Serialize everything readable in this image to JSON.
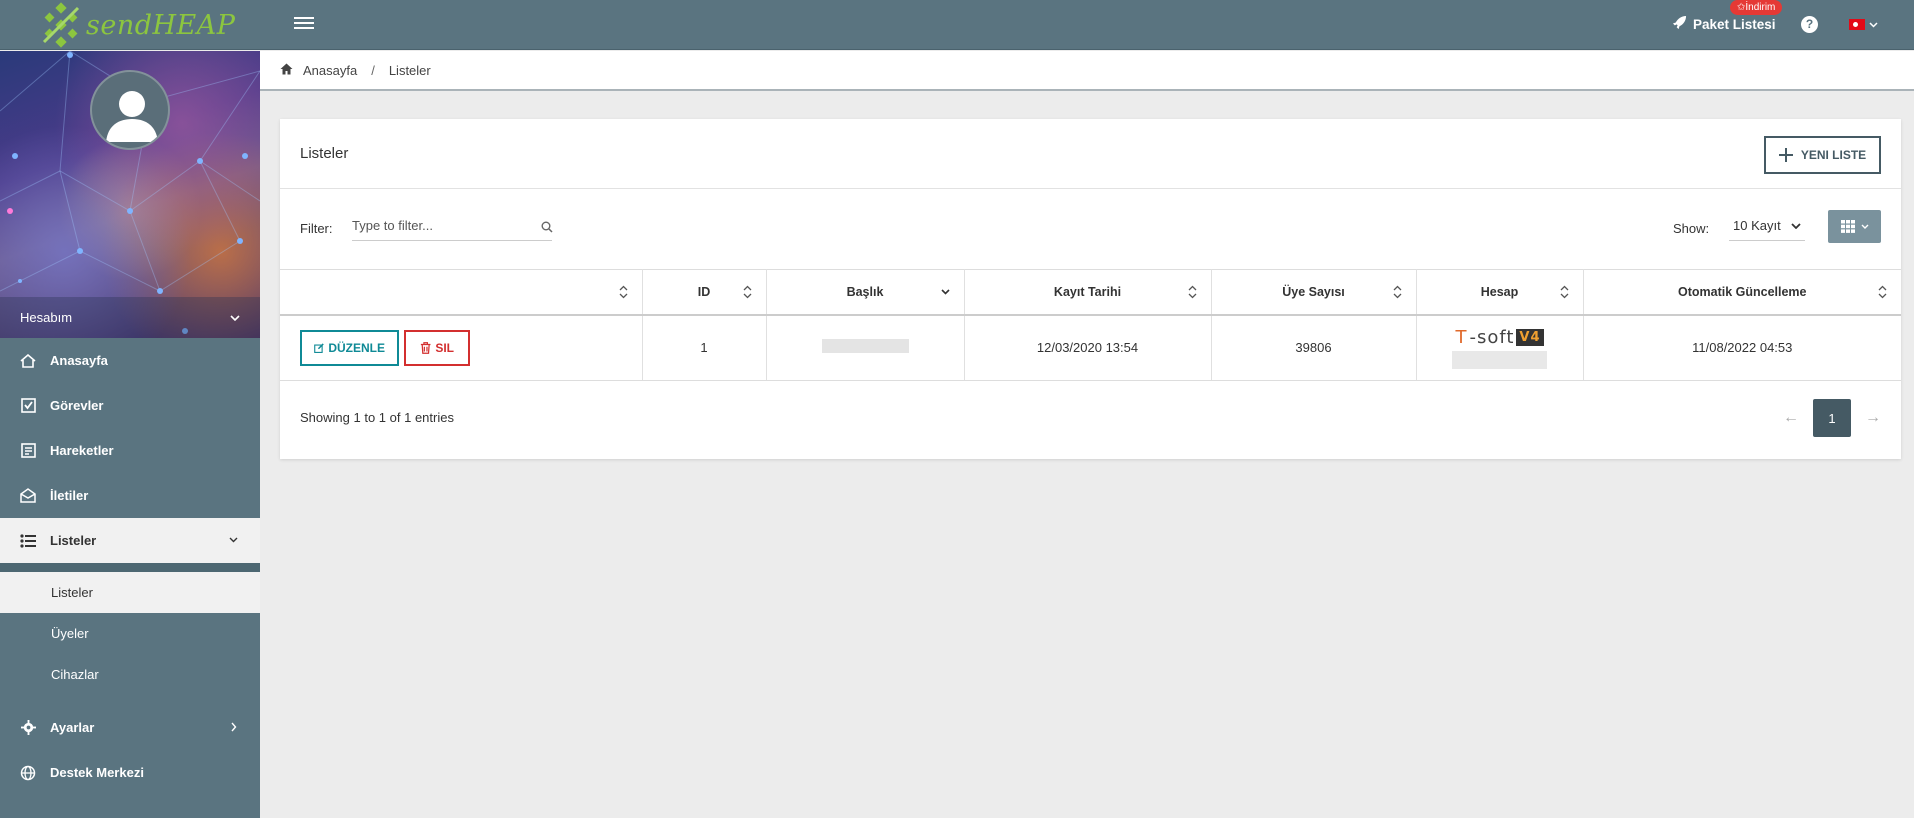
{
  "brand": {
    "name_send": "send",
    "name_heap": "HEAP"
  },
  "topbar": {
    "paket_label": "Paket Listesi",
    "indirim_badge": "✩İndirim",
    "help_glyph": "?"
  },
  "sidebar": {
    "account_label": "Hesabım",
    "items": [
      {
        "label": "Anasayfa",
        "icon": "home-icon"
      },
      {
        "label": "Görevler",
        "icon": "checkbox-icon"
      },
      {
        "label": "Hareketler",
        "icon": "list-box-icon"
      },
      {
        "label": "İletiler",
        "icon": "envelope-icon"
      },
      {
        "label": "Listeler",
        "icon": "list-icon"
      },
      {
        "label": "Ayarlar",
        "icon": "gear-icon"
      },
      {
        "label": "Destek Merkezi",
        "icon": "globe-icon"
      }
    ],
    "sub_items": [
      "Listeler",
      "Üyeler",
      "Cihazlar"
    ]
  },
  "breadcrumb": {
    "home": "Anasayfa",
    "separator": "/",
    "current": "Listeler"
  },
  "card": {
    "title": "Listeler",
    "new_button": "YENI LISTE",
    "filter_label": "Filter:",
    "filter_placeholder": "Type to filter...",
    "show_label": "Show:",
    "show_value": "10 Kayıt"
  },
  "table": {
    "columns": [
      "",
      "ID",
      "Başlık",
      "Kayıt Tarihi",
      "Üye Sayısı",
      "Hesap",
      "Otomatik Güncelleme"
    ],
    "rows": [
      {
        "edit_label": "DÜZENLE",
        "delete_label": "SIL",
        "id": "1",
        "kayit_tarihi": "12/03/2020 13:54",
        "uye_sayisi": "39806",
        "hesap_logo": {
          "t": "T",
          "rest": "-soft",
          "v4": "V4"
        },
        "otomatik_guncelleme": "11/08/2022 04:53"
      }
    ]
  },
  "footer": {
    "showing_prefix": "Showing ",
    "from": "1",
    "to_word": " to ",
    "to": "1",
    "of_word": " of ",
    "total": "1",
    "entries_word": " entries",
    "prev": "←",
    "page": "1",
    "next": "→"
  },
  "colors": {
    "sidebar": "#5a7480",
    "accent_dark": "#455a64",
    "edit": "#0f8a96",
    "delete": "#d32f2f",
    "brand_green": "#8cc63f",
    "badge_red": "#e53935"
  }
}
